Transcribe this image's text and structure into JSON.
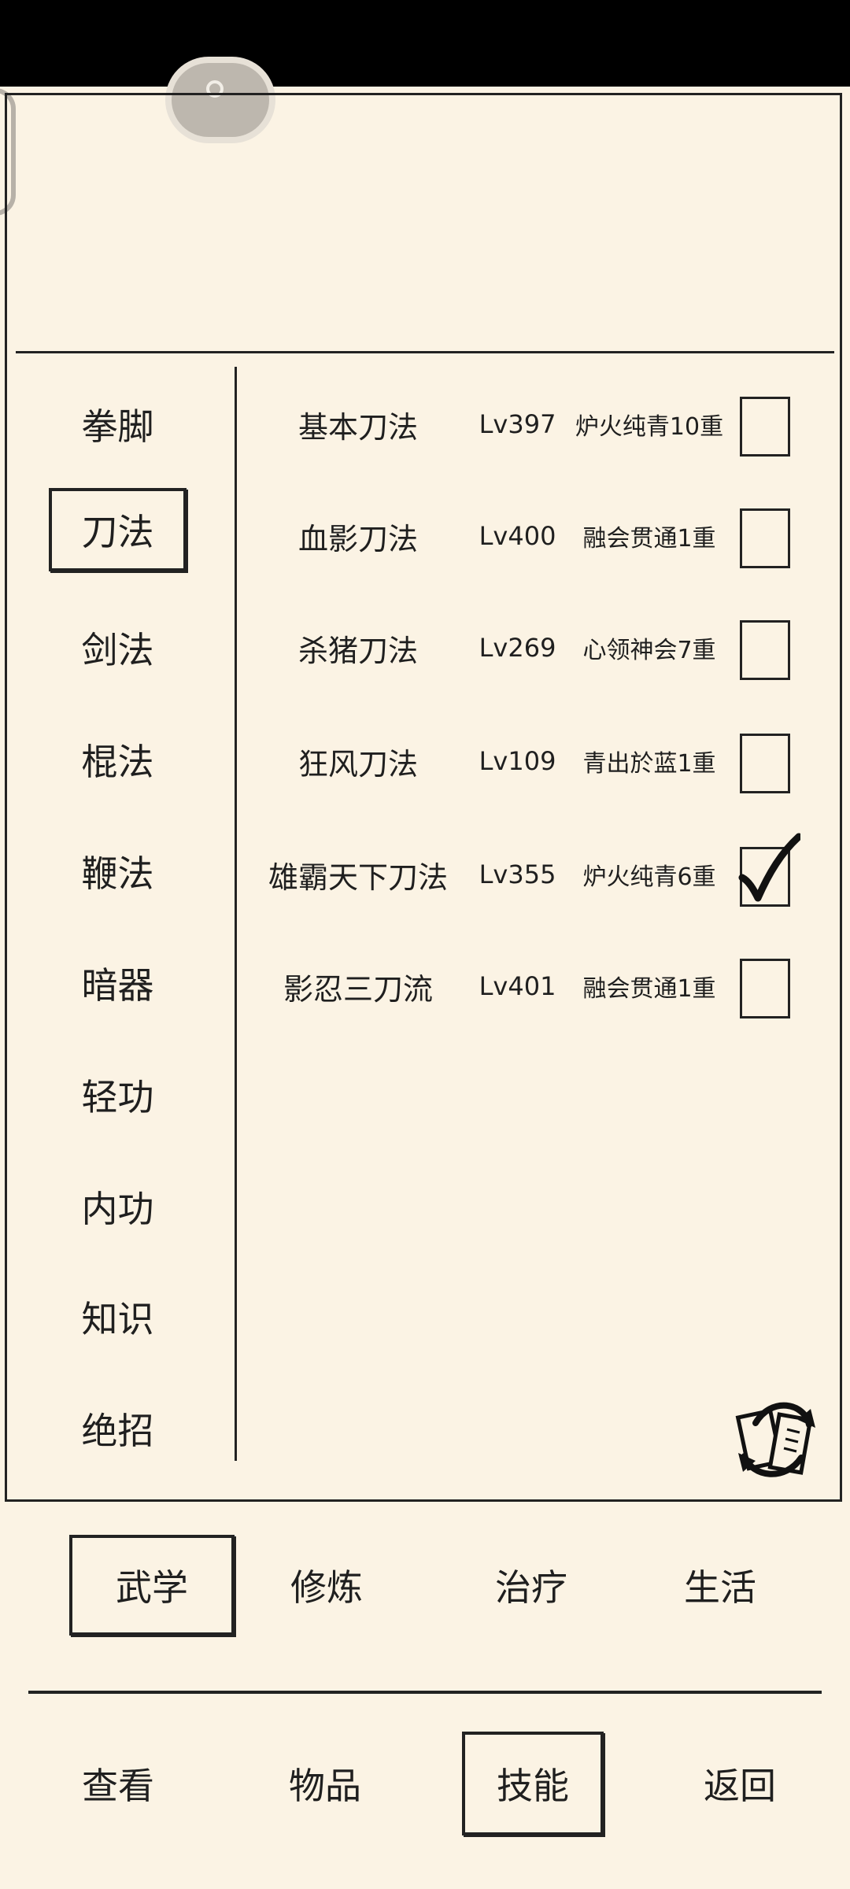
{
  "categories": [
    {
      "label": "拳脚"
    },
    {
      "label": "刀法"
    },
    {
      "label": "剑法"
    },
    {
      "label": "棍法"
    },
    {
      "label": "鞭法"
    },
    {
      "label": "暗器"
    },
    {
      "label": "轻功"
    },
    {
      "label": "内功"
    },
    {
      "label": "知识"
    },
    {
      "label": "绝招"
    }
  ],
  "selected_category": "刀法",
  "skills": [
    {
      "name": "基本刀法",
      "level": "Lv397",
      "realm": "炉火纯青10重",
      "checked": false
    },
    {
      "name": "血影刀法",
      "level": "Lv400",
      "realm": "融会贯通1重",
      "checked": false
    },
    {
      "name": "杀猪刀法",
      "level": "Lv269",
      "realm": "心领神会7重",
      "checked": false
    },
    {
      "name": "狂风刀法",
      "level": "Lv109",
      "realm": "青出於蓝1重",
      "checked": false
    },
    {
      "name": "雄霸天下刀法",
      "level": "Lv355",
      "realm": "炉火纯青6重",
      "checked": true
    },
    {
      "name": "影忍三刀流",
      "level": "Lv401",
      "realm": "融会贯通1重",
      "checked": false
    }
  ],
  "tabs": [
    {
      "label": "武学"
    },
    {
      "label": "修炼"
    },
    {
      "label": "治疗"
    },
    {
      "label": "生活"
    }
  ],
  "selected_tab": "武学",
  "nav": [
    {
      "label": "查看"
    },
    {
      "label": "物品"
    },
    {
      "label": "技能"
    },
    {
      "label": "返回"
    }
  ],
  "selected_nav": "技能",
  "icons": {
    "refresh": "refresh-scroll-icon",
    "check": "checkmark-icon",
    "floating": "floating-assist-button"
  },
  "colors": {
    "background": "#fbf3e4",
    "ink": "#222222"
  }
}
